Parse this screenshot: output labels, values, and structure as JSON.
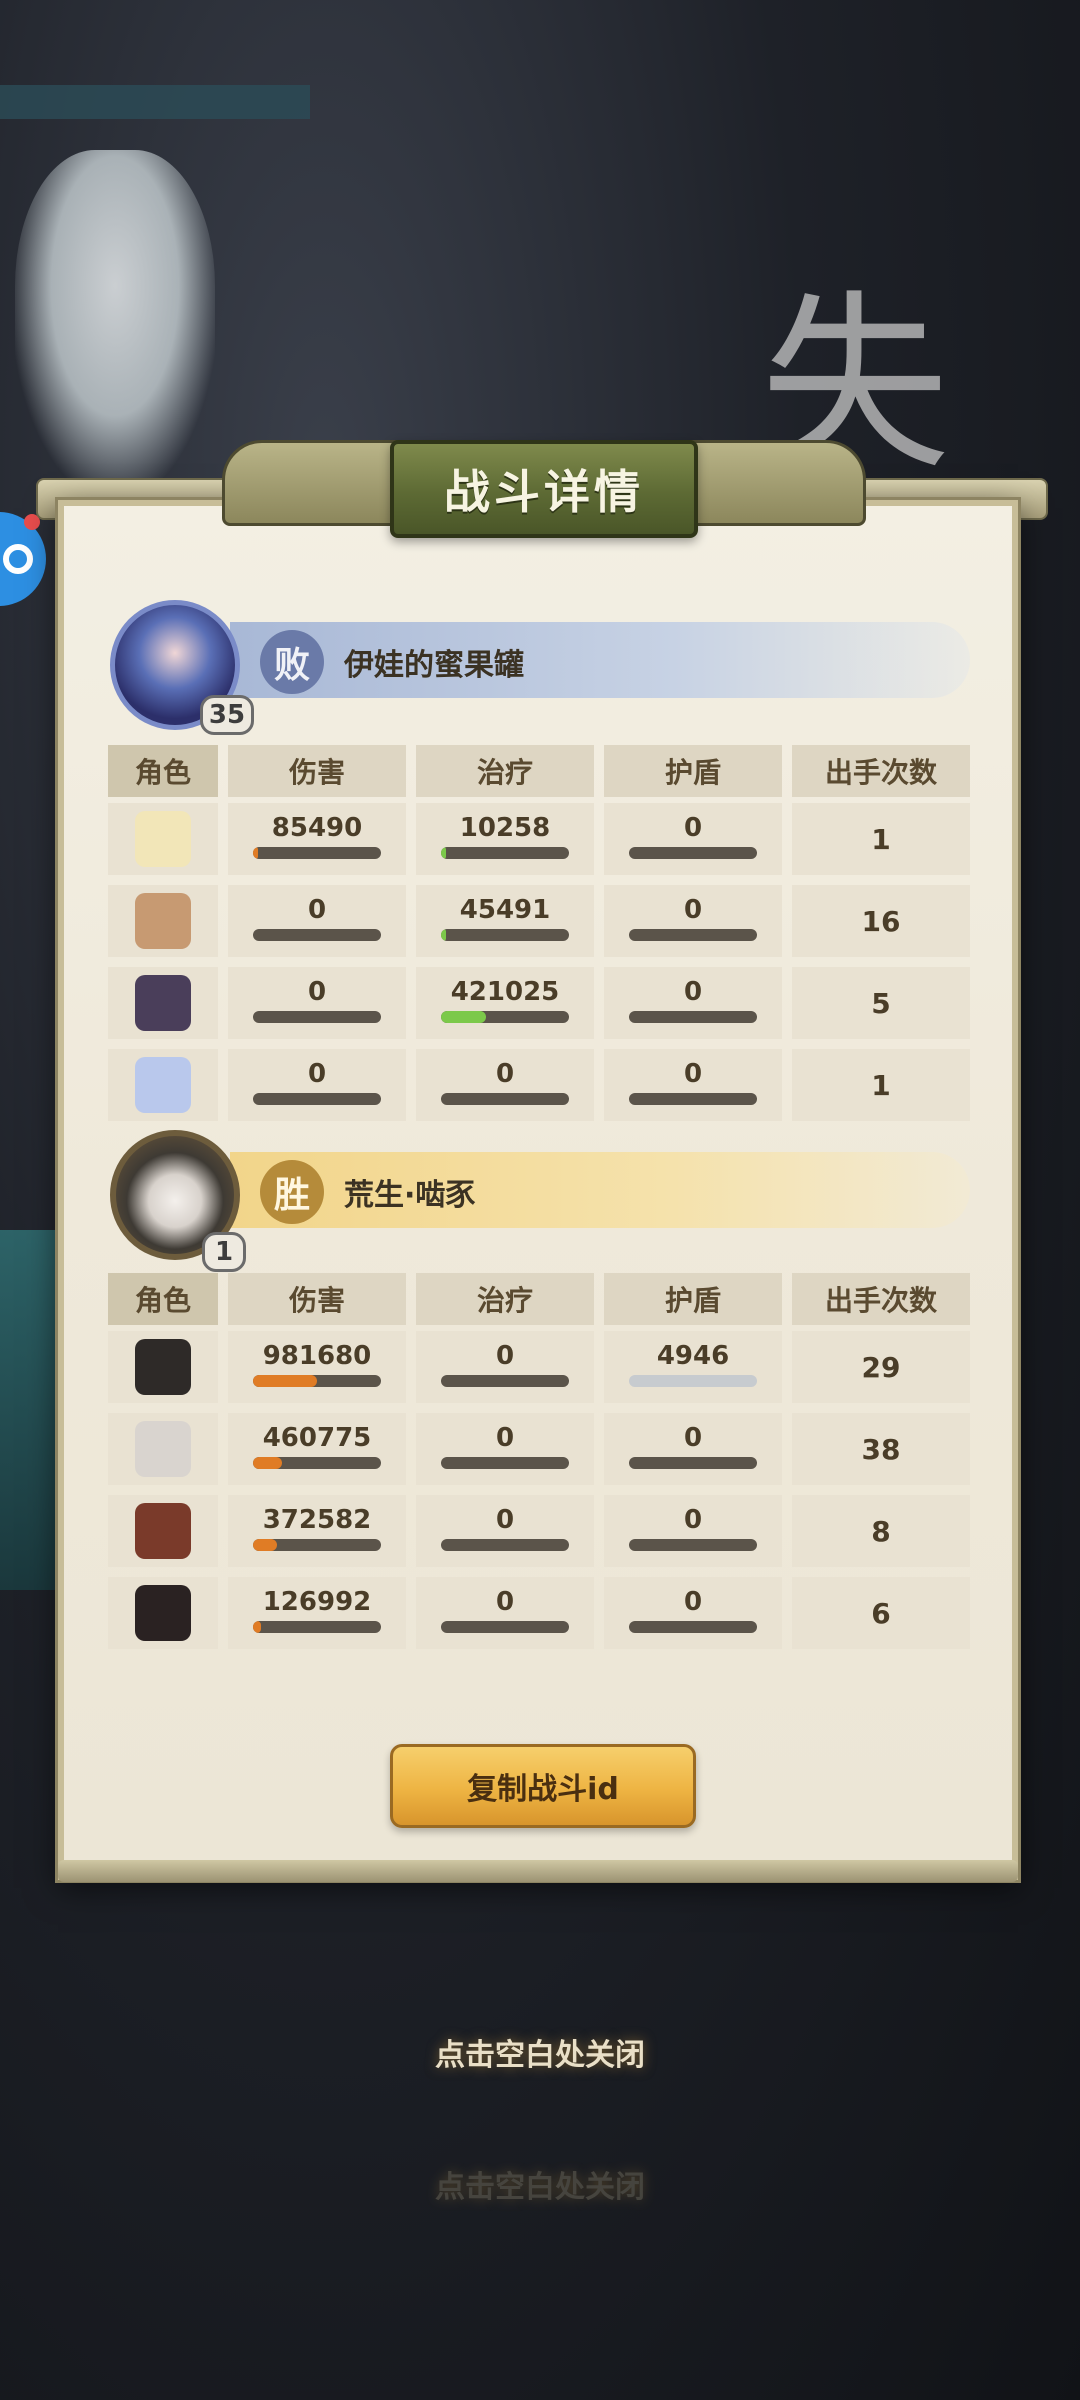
{
  "title": "战斗详情",
  "background_text": "失",
  "headers": {
    "role": "角色",
    "damage": "伤害",
    "heal": "治疗",
    "shield": "护盾",
    "actions": "出手次数"
  },
  "losing_team": {
    "result": "败",
    "player_name": "伊娃的蜜果罐",
    "level": "35",
    "rows": [
      {
        "damage": "85490",
        "damage_fraction": 0.04,
        "heal": "10258",
        "heal_fraction": 0.02,
        "shield": "0",
        "actions": "1",
        "hero_color": "#f2e6b8"
      },
      {
        "damage": "0",
        "damage_fraction": 0,
        "heal": "45491",
        "heal_fraction": 0.04,
        "shield": "0",
        "actions": "16",
        "hero_color": "#c79a72"
      },
      {
        "damage": "0",
        "damage_fraction": 0,
        "heal": "421025",
        "heal_fraction": 0.35,
        "shield": "0",
        "actions": "5",
        "hero_color": "#4a3e5a"
      },
      {
        "damage": "0",
        "damage_fraction": 0,
        "heal": "0",
        "heal_fraction": 0,
        "shield": "0",
        "actions": "1",
        "hero_color": "#b9c8ec"
      }
    ]
  },
  "winning_team": {
    "result": "胜",
    "player_name": "荒生·啮豕",
    "level": "1",
    "rows": [
      {
        "damage": "981680",
        "damage_fraction": 0.5,
        "heal": "0",
        "heal_fraction": 0,
        "shield": "4946",
        "shield_full": true,
        "actions": "29",
        "hero_color": "#2e2a28"
      },
      {
        "damage": "460775",
        "damage_fraction": 0.23,
        "heal": "0",
        "heal_fraction": 0,
        "shield": "0",
        "shield_full": false,
        "actions": "38",
        "hero_color": "#d9d4cf"
      },
      {
        "damage": "372582",
        "damage_fraction": 0.19,
        "heal": "0",
        "heal_fraction": 0,
        "shield": "0",
        "shield_full": false,
        "actions": "8",
        "hero_color": "#7a3a2a"
      },
      {
        "damage": "126992",
        "damage_fraction": 0.06,
        "heal": "0",
        "heal_fraction": 0,
        "shield": "0",
        "shield_full": false,
        "actions": "6",
        "hero_color": "#2a2222"
      }
    ]
  },
  "copy_button": "复制战斗id",
  "close_tip": "点击空白处关闭",
  "colors": {
    "damage_bar": "#e07c25",
    "heal_bar": "#7cc94a",
    "shield_bar_full": "#c7cbcf",
    "empty_bar": "#5b544a"
  }
}
